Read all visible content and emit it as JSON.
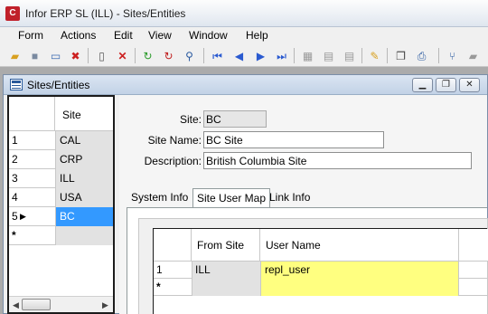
{
  "app": {
    "title": "Infor ERP SL (ILL) - Sites/Entities",
    "icon": "infor-logo-icon"
  },
  "menu": [
    "Form",
    "Actions",
    "Edit",
    "View",
    "Window",
    "Help"
  ],
  "toolbar": {
    "icons": [
      "open-folder-icon",
      "save-icon",
      "new-window-icon",
      "delete-window-icon",
      "new-record-icon",
      "delete-icon",
      "refresh-icon",
      "refresh-all-icon",
      "search-icon",
      "first-record-icon",
      "previous-record-icon",
      "next-record-icon",
      "last-record-icon",
      "grid-icon",
      "filter-icon",
      "filter-edit-icon",
      "notes-icon",
      "copy-icon",
      "print-icon",
      "tree-icon",
      "folder-icon"
    ]
  },
  "child_window": {
    "title": "Sites/Entities",
    "controls": {
      "minimize": "▁",
      "restore": "❐",
      "close": "✕"
    }
  },
  "site_grid": {
    "column": "Site",
    "rows": [
      {
        "num": "1",
        "site": "CAL"
      },
      {
        "num": "2",
        "site": "CRP"
      },
      {
        "num": "3",
        "site": "ILL"
      },
      {
        "num": "4",
        "site": "USA"
      },
      {
        "num": "5",
        "site": "BC",
        "selected": true
      }
    ],
    "new_row_marker": "*",
    "current_row_marker": "▶"
  },
  "form": {
    "site_label": "Site:",
    "site_value": "BC",
    "site_name_label": "Site Name:",
    "site_name_value": "BC Site",
    "description_label": "Description:",
    "description_value": "British Columbia Site",
    "tabs": [
      "System Info",
      "Site User Map",
      "Link Info"
    ],
    "active_tab": "Site User Map"
  },
  "user_map_grid": {
    "columns": [
      "From Site",
      "User Name"
    ],
    "rows": [
      {
        "num": "1",
        "from_site": "ILL",
        "user_name": "repl_user"
      }
    ],
    "new_row_marker": "*"
  }
}
